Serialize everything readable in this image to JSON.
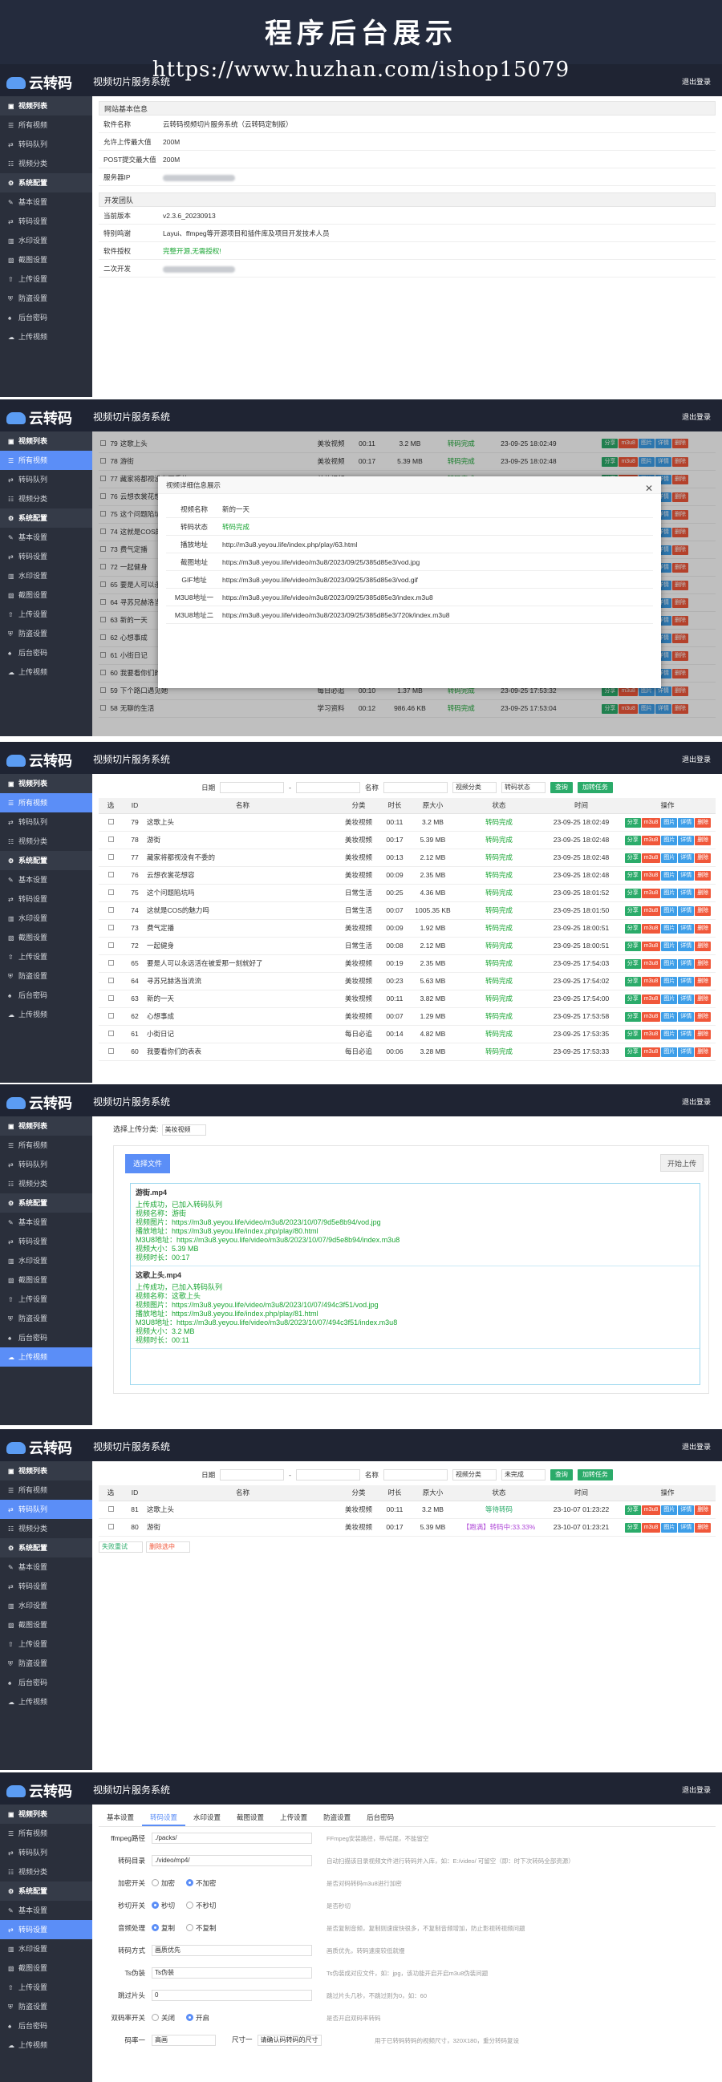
{
  "hero": {
    "title": "程序后台展示",
    "url": "https://www.huzhan.com/ishop15079"
  },
  "app": {
    "logo": "云转码",
    "title": "视频切片服务系统",
    "logout": "退出登录"
  },
  "sidebar": {
    "items": [
      {
        "label": "视频列表",
        "group": true
      },
      {
        "label": "所有视频"
      },
      {
        "label": "转码队列"
      },
      {
        "label": "视频分类"
      },
      {
        "label": "系统配置",
        "group": true
      },
      {
        "label": "基本设置"
      },
      {
        "label": "转码设置"
      },
      {
        "label": "水印设置"
      },
      {
        "label": "截图设置"
      },
      {
        "label": "上传设置"
      },
      {
        "label": "防盗设置"
      },
      {
        "label": "后台密码"
      },
      {
        "label": "上传视频"
      }
    ]
  },
  "panel1": {
    "site_title": "网站基本信息",
    "site_rows": [
      {
        "k": "软件名称",
        "v": "云转码视频切片服务系统（云转码定制版）"
      },
      {
        "k": "允许上传最大值",
        "v": "200M"
      },
      {
        "k": "POST提交最大值",
        "v": "200M"
      },
      {
        "k": "服务器IP",
        "v": ""
      }
    ],
    "dev_title": "开发团队",
    "dev_rows": [
      {
        "k": "当前版本",
        "v": "v2.3.6_20230913"
      },
      {
        "k": "特别鸣谢",
        "v": "Layui、ffmpeg等开源项目和插件库及项目开发技术人员"
      },
      {
        "k": "软件授权",
        "v": "完整开源,无需授权!"
      },
      {
        "k": "二次开发",
        "v": ""
      }
    ]
  },
  "table_rows": [
    {
      "id": "79",
      "name": "这歌上头",
      "cat": "美妆视频",
      "dur": "00:11",
      "size": "3.2 MB",
      "status": "转码完成",
      "time": "23-09-25 18:02:49"
    },
    {
      "id": "78",
      "name": "游街",
      "cat": "美妆视频",
      "dur": "00:17",
      "size": "5.39 MB",
      "status": "转码完成",
      "time": "23-09-25 18:02:48"
    },
    {
      "id": "77",
      "name": "藏家将都视没有不委的",
      "cat": "美妆视频",
      "dur": "00:13",
      "size": "2.12 MB",
      "status": "转码完成",
      "time": "23-09-25 18:02:48"
    },
    {
      "id": "76",
      "name": "云想衣裳花想容",
      "cat": "美妆视频",
      "dur": "00:09",
      "size": "2.35 MB",
      "status": "转码完成",
      "time": "23-09-25 18:02:48"
    },
    {
      "id": "75",
      "name": "这个问题陷坑吗",
      "cat": "日常生活",
      "dur": "00:25",
      "size": "4.36 MB",
      "status": "转码完成",
      "time": "23-09-25 18:01:52"
    },
    {
      "id": "74",
      "name": "这就是COS的魅力吗",
      "cat": "日常生活",
      "dur": "00:07",
      "size": "1005.35 KB",
      "status": "转码完成",
      "time": "23-09-25 18:01:50"
    },
    {
      "id": "73",
      "name": "费气定播",
      "cat": "美妆视频",
      "dur": "00:09",
      "size": "1.92 MB",
      "status": "转码完成",
      "time": "23-09-25 18:00:51"
    },
    {
      "id": "72",
      "name": "一起健身",
      "cat": "日常生活",
      "dur": "00:08",
      "size": "2.12 MB",
      "status": "转码完成",
      "time": "23-09-25 18:00:51"
    },
    {
      "id": "65",
      "name": "要是人可以永远活在被爱那一刻就好了",
      "cat": "美妆视频",
      "dur": "00:19",
      "size": "2.35 MB",
      "status": "转码完成",
      "time": "23-09-25 17:54:03"
    },
    {
      "id": "64",
      "name": "寻苏兄赫洛当流流",
      "cat": "美妆视频",
      "dur": "00:23",
      "size": "5.63 MB",
      "status": "转码完成",
      "time": "23-09-25 17:54:02"
    },
    {
      "id": "63",
      "name": "新的一天",
      "cat": "美妆视频",
      "dur": "00:11",
      "size": "3.82 MB",
      "status": "转码完成",
      "time": "23-09-25 17:54:00"
    },
    {
      "id": "62",
      "name": "心想事成",
      "cat": "美妆视频",
      "dur": "00:07",
      "size": "1.29 MB",
      "status": "转码完成",
      "time": "23-09-25 17:53:58"
    },
    {
      "id": "61",
      "name": "小街日记",
      "cat": "每日必追",
      "dur": "00:14",
      "size": "4.82 MB",
      "status": "转码完成",
      "time": "23-09-25 17:53:35"
    },
    {
      "id": "60",
      "name": "我要看你们的表表",
      "cat": "每日必追",
      "dur": "00:06",
      "size": "3.28 MB",
      "status": "转码完成",
      "time": "23-09-25 17:53:33"
    }
  ],
  "panel2_extra": [
    {
      "id": "59",
      "name": "下个路口遇见她",
      "cat": "每日必追",
      "dur": "00:10",
      "size": "1.37 MB",
      "status": "转码完成",
      "time": "23-09-25 17:53:32"
    },
    {
      "id": "58",
      "name": "无聊的生活",
      "cat": "学习资料",
      "dur": "00:12",
      "size": "986.46 KB",
      "status": "转码完成",
      "time": "23-09-25 17:53:04"
    }
  ],
  "action_btns": [
    "分享",
    "m3u8",
    "图片",
    "详情",
    "删除"
  ],
  "modal": {
    "title": "视频详细信息展示",
    "rows": [
      {
        "k": "视频名称",
        "v": "新的一天"
      },
      {
        "k": "转码状态",
        "v": "转码完成"
      },
      {
        "k": "播放地址",
        "v": "http://m3u8.yeyou.life/index.php/play/63.html"
      },
      {
        "k": "截图地址",
        "v": "https://m3u8.yeyou.life/video/m3u8/2023/09/25/385d85e3/vod.jpg"
      },
      {
        "k": "GIF地址",
        "v": "https://m3u8.yeyou.life/video/m3u8/2023/09/25/385d85e3/vod.gif"
      },
      {
        "k": "M3U8地址一",
        "v": "https://m3u8.yeyou.life/video/m3u8/2023/09/25/385d85e3/index.m3u8"
      },
      {
        "k": "M3U8地址二",
        "v": "https://m3u8.yeyou.life/video/m3u8/2023/09/25/385d85e3/720k/index.m3u8"
      }
    ]
  },
  "filter": {
    "date_label": "日期",
    "dash": "-",
    "name_label": "名称",
    "cat_sel": "视频分类",
    "status_sel": "转码状态",
    "status_sel2": "未完成",
    "search": "查询",
    "add": "加转任务"
  },
  "headers": {
    "sel": "选",
    "id": "ID",
    "name": "名称",
    "cat": "分类",
    "dur": "时长",
    "size": "原大小",
    "status": "状态",
    "time": "时间",
    "ops": "操作"
  },
  "upload": {
    "cat_label": "选择上传分类:",
    "cat_value": "美妆视频",
    "pick": "选择文件",
    "start": "开始上传",
    "files": [
      {
        "name": "游街.mp4",
        "lines": [
          "上传成功，已加入转码队列",
          "视频名称：游街",
          "视频图片：https://m3u8.yeyou.life/video/m3u8/2023/10/07/9d5e8b94/vod.jpg",
          "播放地址：https://m3u8.yeyou.life/index.php/play/80.html",
          "M3U8地址：https://m3u8.yeyou.life/video/m3u8/2023/10/07/9d5e8b94/index.m3u8",
          "视频大小：5.39 MB",
          "视频时长：00:17"
        ]
      },
      {
        "name": "这歌上头.mp4",
        "lines": [
          "上传成功，已加入转码队列",
          "视频名称：这歌上头",
          "视频图片：https://m3u8.yeyou.life/video/m3u8/2023/10/07/494c3f51/vod.jpg",
          "播放地址：https://m3u8.yeyou.life/index.php/play/81.html",
          "M3U8地址：https://m3u8.yeyou.life/video/m3u8/2023/10/07/494c3f51/index.m3u8",
          "视频大小：3.2 MB",
          "视频时长：00:11"
        ]
      }
    ]
  },
  "queue": {
    "rows": [
      {
        "id": "81",
        "name": "这歌上头",
        "cat": "美妆视频",
        "dur": "00:11",
        "size": "3.2 MB",
        "status": "等待转码",
        "time": "23-10-07 01:23:22"
      },
      {
        "id": "80",
        "name": "游街",
        "cat": "美妆视频",
        "dur": "00:17",
        "size": "5.39 MB",
        "status": "【跑满】转码中:33.33%",
        "time": "23-10-07 01:23:21"
      }
    ],
    "retry": "失败重试",
    "del": "删除选中"
  },
  "settings": {
    "tabs": [
      "基本设置",
      "转码设置",
      "水印设置",
      "截图设置",
      "上传设置",
      "防盗设置",
      "后台密码"
    ],
    "active_tab": 1,
    "rows": [
      {
        "k": "ffmpeg路径",
        "v": "./packs/",
        "hint": "FFmpeg安装路径，带/结尾，不能留空",
        "type": "input"
      },
      {
        "k": "转码目录",
        "v": "./video/mp4/",
        "hint": "自动扫描该目录视频文件进行转码并入库，如：E:/video/ 可留空（即：时下次转码全部资源）",
        "type": "input"
      },
      {
        "k": "加密开关",
        "opts": [
          "加密",
          "不加密"
        ],
        "on": 1,
        "hint": "是否对码转码m3u8进行加密",
        "type": "radio"
      },
      {
        "k": "秒切开关",
        "opts": [
          "秒切",
          "不秒切"
        ],
        "on": 0,
        "hint": "是否秒切",
        "type": "radio"
      },
      {
        "k": "音频处理",
        "opts": [
          "复制",
          "不复制"
        ],
        "on": 0,
        "hint": "是否复制音频，复制则速度快很多，不复制音频增加，防止影视转视频问题",
        "type": "radio"
      },
      {
        "k": "转码方式",
        "v": "画质优先",
        "hint": "画质优先，转码速度较低就慢",
        "type": "select"
      },
      {
        "k": "Ts伪装",
        "v": "Ts伪装",
        "hint": "Ts伪装成对应文件，如：jpg，该功能开启开启m3u8伪装问题",
        "type": "input"
      },
      {
        "k": "跳过片头",
        "v": "0",
        "hint": "跳过片头几秒，不跳过则为0，如：60",
        "type": "input"
      },
      {
        "k": "双码率开关",
        "opts": [
          "关闭",
          "开启"
        ],
        "on": 1,
        "hint": "是否开启双码率转码",
        "type": "radio"
      },
      {
        "k": "码率一",
        "v": "高画",
        "k2": "尺寸一",
        "v2": "请确认码转码的尺寸",
        "hint": "用于已转码转码的视频尺寸，320X180，重分转码复设",
        "type": "select2"
      }
    ]
  }
}
